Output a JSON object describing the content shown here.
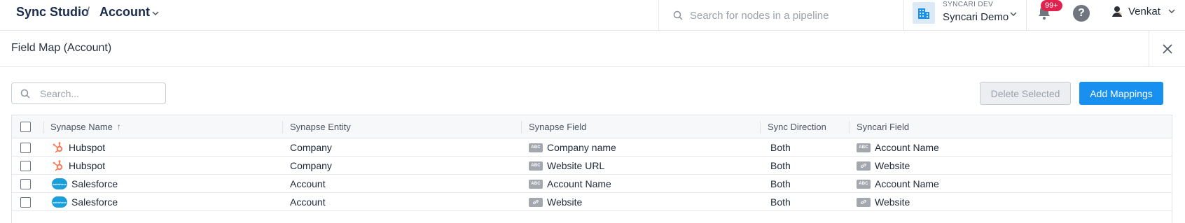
{
  "topbar": {
    "brand": "Sync Studio",
    "separator": "/",
    "current_object": "Account",
    "search_placeholder": "Search for nodes in a pipeline",
    "org_env": "SYNCARI DEV",
    "org_name": "Syncari Demo",
    "notification_count": "99+",
    "help_label": "?",
    "user_name": "Venkat"
  },
  "modal": {
    "title": "Field Map (Account)"
  },
  "toolbar": {
    "search_placeholder": "Search...",
    "delete_label": "Delete Selected",
    "add_label": "Add Mappings"
  },
  "table": {
    "headers": {
      "synapse_name": "Synapse Name",
      "synapse_entity": "Synapse Entity",
      "synapse_field": "Synapse Field",
      "sync_direction": "Sync Direction",
      "syncari_field": "Syncari Field"
    },
    "sort_indicator": "↑",
    "rows": [
      {
        "synapse": "Hubspot",
        "synapse_icon": "hubspot-logo",
        "entity": "Company",
        "field_type": "ABC",
        "field": "Company name",
        "direction": "Both",
        "syncari_type": "ABC",
        "syncari_field": "Account Name"
      },
      {
        "synapse": "Hubspot",
        "synapse_icon": "hubspot-logo",
        "entity": "Company",
        "field_type": "ABC",
        "field": "Website URL",
        "direction": "Both",
        "syncari_type": "link",
        "syncari_field": "Website"
      },
      {
        "synapse": "Salesforce",
        "synapse_icon": "salesforce-logo",
        "entity": "Account",
        "field_type": "ABC",
        "field": "Account Name",
        "direction": "Both",
        "syncari_type": "ABC",
        "syncari_field": "Account Name"
      },
      {
        "synapse": "Salesforce",
        "synapse_icon": "salesforce-logo",
        "entity": "Account",
        "field_type": "link",
        "field": "Website",
        "direction": "Both",
        "syncari_type": "link",
        "syncari_field": "Website"
      }
    ]
  },
  "colors": {
    "accent": "#1890f0",
    "brand_text": "#1a2b4c",
    "badge": "#e0224e",
    "hubspot": "#ff7a59",
    "salesforce": "#1a9fdd"
  }
}
